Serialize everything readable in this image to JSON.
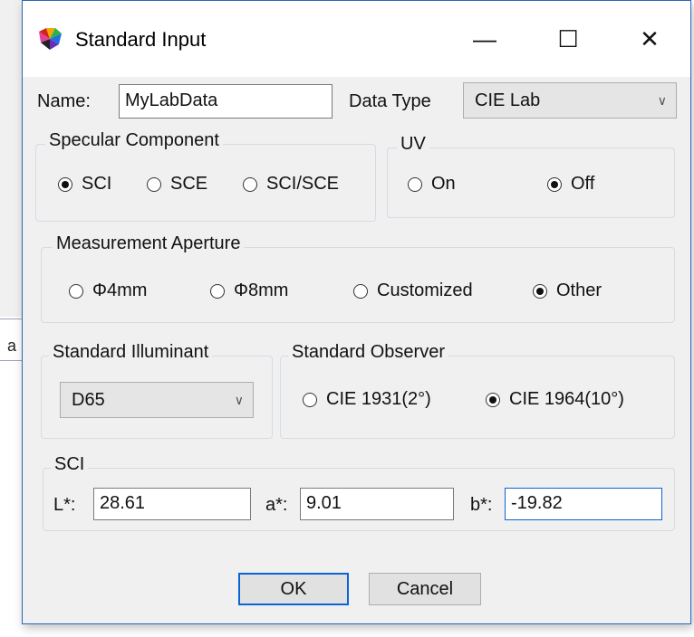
{
  "background": {
    "letter_a_1": "a",
    "letter_a_2": "a"
  },
  "window": {
    "title": "Standard Input",
    "icon": "color-wheel-icon",
    "controls": {
      "minimize": "—",
      "maximize": "☐",
      "close": "✕"
    }
  },
  "name": {
    "label": "Name:",
    "value": "MyLabData"
  },
  "data_type": {
    "label": "Data Type",
    "selected": "CIE Lab"
  },
  "specular": {
    "title": "Specular Component",
    "options": [
      "SCI",
      "SCE",
      "SCI/SCE"
    ],
    "selected": "SCI"
  },
  "uv": {
    "title": "UV",
    "options": [
      "On",
      "Off"
    ],
    "selected": "Off"
  },
  "aperture": {
    "title": "Measurement Aperture",
    "options": [
      "Φ4mm",
      "Φ8mm",
      "Customized",
      "Other"
    ],
    "selected": "Other"
  },
  "illuminant": {
    "title": "Standard Illuminant",
    "selected": "D65"
  },
  "observer": {
    "title": "Standard Observer",
    "options": [
      "CIE 1931(2°)",
      "CIE 1964(10°)"
    ],
    "selected": "CIE 1964(10°)"
  },
  "sci": {
    "title": "SCI",
    "l_label": "L*:",
    "l_value": "28.61",
    "a_label": "a*:",
    "a_value": "9.01",
    "b_label": "b*:",
    "b_value": "-19.82"
  },
  "buttons": {
    "ok": "OK",
    "cancel": "Cancel"
  },
  "colors": {
    "accent": "#0a64d6",
    "window_border": "#2b66b8",
    "dialog_bg": "#f0f0f0"
  }
}
